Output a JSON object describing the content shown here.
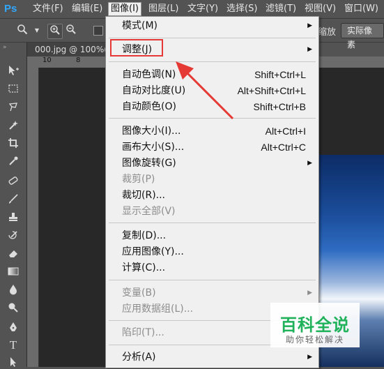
{
  "app": {
    "logo": "Ps"
  },
  "menubar": {
    "items": [
      "文件(F)",
      "编辑(E)",
      "图像(I)",
      "图层(L)",
      "文字(Y)",
      "选择(S)",
      "滤镜(T)",
      "视图(V)",
      "窗口(W)"
    ],
    "active_index": 2
  },
  "options": {
    "partial_text": "缩放",
    "actual_pixels_button": "实际像素"
  },
  "document": {
    "tab_title": "000.jpg @ 100%(R",
    "ruler_marks": [
      "10",
      "8"
    ]
  },
  "image_menu": {
    "items": [
      {
        "label": "模式(M)",
        "shortcut": "",
        "submenu": true,
        "disabled": false
      },
      {
        "label": "调整(J)",
        "shortcut": "",
        "submenu": true,
        "disabled": false
      },
      {
        "label": "自动色调(N)",
        "shortcut": "Shift+Ctrl+L",
        "submenu": false,
        "disabled": false
      },
      {
        "label": "自动对比度(U)",
        "shortcut": "Alt+Shift+Ctrl+L",
        "submenu": false,
        "disabled": false
      },
      {
        "label": "自动颜色(O)",
        "shortcut": "Shift+Ctrl+B",
        "submenu": false,
        "disabled": false
      },
      {
        "label": "图像大小(I)...",
        "shortcut": "Alt+Ctrl+I",
        "submenu": false,
        "disabled": false
      },
      {
        "label": "画布大小(S)...",
        "shortcut": "Alt+Ctrl+C",
        "submenu": false,
        "disabled": false
      },
      {
        "label": "图像旋转(G)",
        "shortcut": "",
        "submenu": true,
        "disabled": false
      },
      {
        "label": "裁剪(P)",
        "shortcut": "",
        "submenu": false,
        "disabled": true
      },
      {
        "label": "裁切(R)...",
        "shortcut": "",
        "submenu": false,
        "disabled": false
      },
      {
        "label": "显示全部(V)",
        "shortcut": "",
        "submenu": false,
        "disabled": true
      },
      {
        "label": "复制(D)...",
        "shortcut": "",
        "submenu": false,
        "disabled": false
      },
      {
        "label": "应用图像(Y)...",
        "shortcut": "",
        "submenu": false,
        "disabled": false
      },
      {
        "label": "计算(C)...",
        "shortcut": "",
        "submenu": false,
        "disabled": false
      },
      {
        "label": "变量(B)",
        "shortcut": "",
        "submenu": true,
        "disabled": true
      },
      {
        "label": "应用数据组(L)...",
        "shortcut": "",
        "submenu": false,
        "disabled": true
      },
      {
        "label": "陷印(T)...",
        "shortcut": "",
        "submenu": false,
        "disabled": true
      },
      {
        "label": "分析(A)",
        "shortcut": "",
        "submenu": true,
        "disabled": false
      }
    ],
    "submenu_glyph": "▶"
  },
  "watermark": {
    "title": "百科全说",
    "subtitle": "助你轻松解决"
  },
  "colors": {
    "highlight": "#e53935",
    "menu_bg": "#f0f0f0",
    "disabled_text": "#8c8c8c",
    "watermark_green": "#1fb25a"
  }
}
